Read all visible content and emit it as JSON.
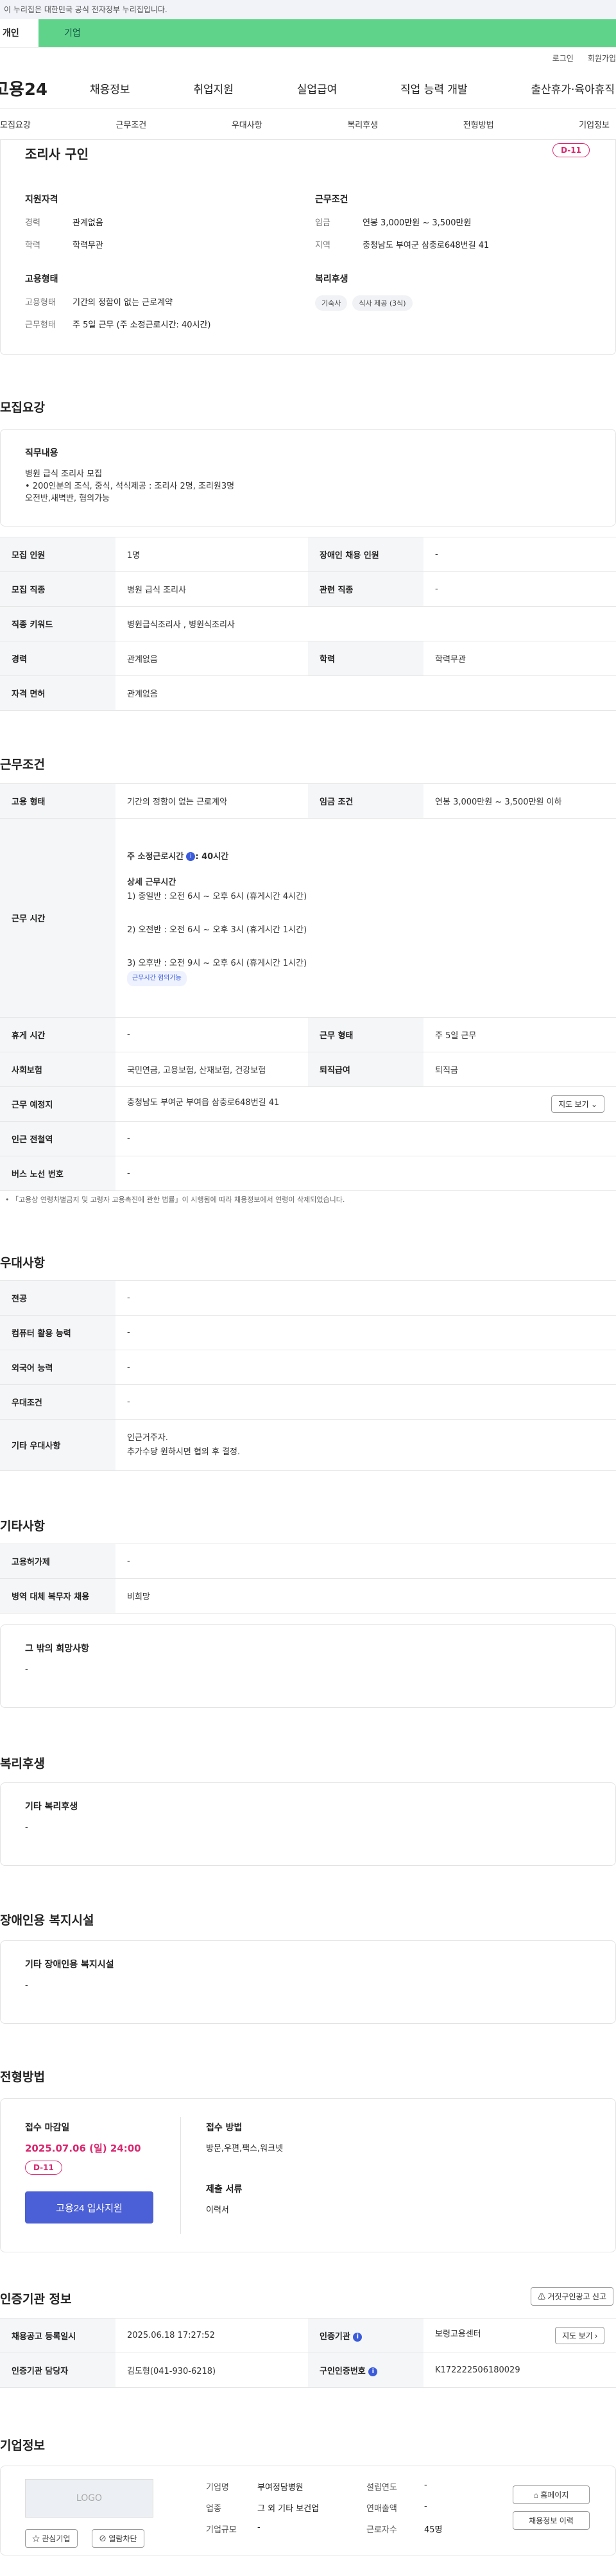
{
  "gov_notice": "이 누리집은 대한민국 공식 전자정부 누리집입니다.",
  "tabs": {
    "personal": "개인",
    "enterprise": "기업"
  },
  "util": {
    "login": "로그인",
    "signup": "회원가입"
  },
  "logo": "고용24",
  "gnb": [
    "채용정보",
    "취업지원",
    "실업급여",
    "직업 능력 개발",
    "출산휴가·육아휴직"
  ],
  "anchors": [
    "모집요강",
    "근무조건",
    "우대사항",
    "복리후생",
    "전형방법",
    "기업정보"
  ],
  "summary": {
    "title": "조리사 구인",
    "dday": "D-11",
    "qual_title": "지원자격",
    "career_k": "경력",
    "career_v": "관계없음",
    "edu_k": "학력",
    "edu_v": "학력무관",
    "cond_title": "근무조건",
    "wage_k": "임금",
    "wage_v": "연봉 3,000만원 ~ 3,500만원",
    "region_k": "지역",
    "region_v": "충청남도 부여군 삼충로648번길 41",
    "emp_title": "고용형태",
    "emptype_k": "고용형태",
    "emptype_v": "기간의 정함이 없는 근로계약",
    "worktype_k": "근무형태",
    "worktype_v": "주 5일 근무 (주 소정근로시간: 40시간)",
    "welfare_title": "복리후생",
    "chips": [
      "기숙사",
      "식사 제공 (3식)"
    ]
  },
  "recruit": {
    "section": "모집요강",
    "job_title": "직무내용",
    "job_text": "병원 급식 조리사 모집\n• 200인분의 조식, 중식, 석식제공 : 조리사 2명, 조리원3명\n오전반,새벽반, 협의가능",
    "rows": [
      [
        "모집 인원",
        "1명",
        "장애인 채용 인원",
        "-"
      ],
      [
        "모집 직종",
        "병원 급식 조리사",
        "관련 직종",
        "-"
      ],
      [
        "직종 키워드",
        "병원급식조리사 , 병원식조리사",
        "",
        ""
      ],
      [
        "경력",
        "관계없음",
        "학력",
        "학력무관"
      ],
      [
        "자격 면허",
        "관계없음",
        "",
        ""
      ]
    ]
  },
  "condition": {
    "section": "근무조건",
    "emp_k": "고용 형태",
    "emp_v": "기간의 정함이 없는 근로계약",
    "wage_k": "임금 조건",
    "wage_v": "연봉 3,000만원 ~ 3,500만원 이하",
    "time_k": "근무 시간",
    "time_main": "주 소정근로시간",
    "time_hours": ": 40시간",
    "detail_title": "상세 근무시간",
    "shift1": "1) 중일반 : 오전 6시 ~ 오후 6시 (휴게시간 4시간)",
    "shift2": "2) 오전반 : 오전 6시 ~ 오후 3시 (휴게시간 1시간)",
    "shift3": "3) 오후반 : 오전 9시 ~ 오후 6시 (휴게시간 1시간)",
    "pill": "근무시간 협의가능",
    "rest_k": "휴게 시간",
    "rest_v": "-",
    "form_k": "근무 형태",
    "form_v": "주 5일 근무",
    "ins_k": "사회보험",
    "ins_v": "국민연금, 고용보험, 산재보험, 건강보험",
    "sev_k": "퇴직급여",
    "sev_v": "퇴직금",
    "place_k": "근무 예정지",
    "place_v": "충청남도 부여군 부여읍 삼충로648번길 41",
    "map_btn": "지도 보기",
    "subway_k": "인근 전철역",
    "subway_v": "-",
    "bus_k": "버스 노선 번호",
    "bus_v": "-",
    "note": "「고용상 연령차별금지 및 고령자 고용촉진에 관한 법률」이 시행됨에 따라 채용정보에서 연령이 삭제되었습니다."
  },
  "pref": {
    "section": "우대사항",
    "rows": [
      [
        "전공",
        "-"
      ],
      [
        "컴퓨터 활용 능력",
        "-"
      ],
      [
        "외국어 능력",
        "-"
      ],
      [
        "우대조건",
        "-"
      ]
    ],
    "etc_k": "기타 우대사항",
    "etc_v": "인근거주자.\n추가수당 원하시면 협의 후 결정."
  },
  "other": {
    "section": "기타사항",
    "rows": [
      [
        "고용허가제",
        "-"
      ],
      [
        "병역 대체 복무자 채용",
        "비희망"
      ]
    ],
    "box_title": "그 밖의 희망사항",
    "box_text": "-"
  },
  "welfare": {
    "section": "복리후생",
    "box_title": "기타 복리후생",
    "box_text": "-"
  },
  "disability": {
    "section": "장애인용 복지시설",
    "box_title": "기타 장애인용 복지시설",
    "box_text": "-"
  },
  "process": {
    "section": "전형방법",
    "deadline_k": "접수 마감일",
    "deadline_v": "2025.07.06 (일) 24:00",
    "dday": "D-11",
    "apply_btn": "고용24 입사지원",
    "method_k": "접수 방법",
    "method_v": "방문,우편,팩스,워크넷",
    "docs_k": "제출 서류",
    "docs_v": "이력서"
  },
  "agency": {
    "section": "인증기관 정보",
    "report_btn": "거짓구인광고 신고",
    "reg_k": "채용공고 등록일시",
    "reg_v": "2025.06.18 17:27:52",
    "org_k": "인증기관",
    "org_v": "보령고용센터",
    "map_btn": "지도 보기",
    "mgr_k": "인증기관 담당자",
    "mgr_v": "김도형(041-930-6218)",
    "no_k": "구인인증번호",
    "no_v": "K172222506180029"
  },
  "company": {
    "section": "기업정보",
    "logo": "LOGO",
    "interest_btn": "관심기업",
    "block_btn": "열람차단",
    "name_k": "기업명",
    "name_v": "부여정담병원",
    "year_k": "설립연도",
    "year_v": "-",
    "biz_k": "업종",
    "biz_v": "그 외 기타 보건업",
    "rev_k": "연매출액",
    "rev_v": "-",
    "size_k": "기업규모",
    "size_v": "-",
    "emp_k": "근로자수",
    "emp_v": "45명",
    "home_btn": "홈페이지",
    "jobs_btn": "채용정보 이력"
  },
  "colors": {
    "accent": "#4b5fd6",
    "dday": "#d9266e",
    "green": "#5fd38a"
  }
}
